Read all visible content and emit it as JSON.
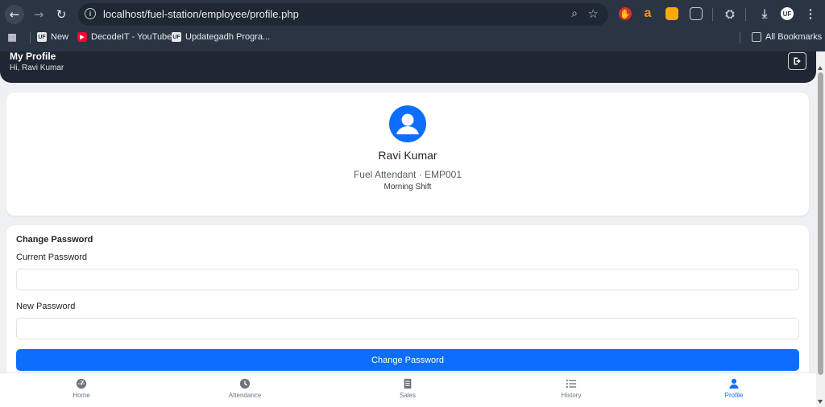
{
  "browser": {
    "url": "localhost/fuel-station/employee/profile.php",
    "bookmarks": [
      {
        "label": "New"
      },
      {
        "label": "DecodeIT - YouTube"
      },
      {
        "label": "Updategadh Progra..."
      }
    ],
    "all_bookmarks": "All Bookmarks"
  },
  "header": {
    "title": "My Profile",
    "greeting": "Hi, Ravi Kumar"
  },
  "profile": {
    "name": "Ravi Kumar",
    "role_line": "Fuel Attendant · EMP001",
    "shift": "Morning Shift"
  },
  "change_password": {
    "title": "Change Password",
    "current_label": "Current Password",
    "current_value": "",
    "new_label": "New Password",
    "new_value": "",
    "submit_label": "Change Password"
  },
  "nav": [
    {
      "label": "Home",
      "icon": "gauge-icon"
    },
    {
      "label": "Attendance",
      "icon": "clock-icon"
    },
    {
      "label": "Sales",
      "icon": "receipt-icon"
    },
    {
      "label": "History",
      "icon": "list-icon"
    },
    {
      "label": "Profile",
      "icon": "user-icon",
      "active": true
    }
  ],
  "colors": {
    "primary": "#0d6efd",
    "header_bg": "#1f2733",
    "page_bg": "#eef0f3"
  }
}
